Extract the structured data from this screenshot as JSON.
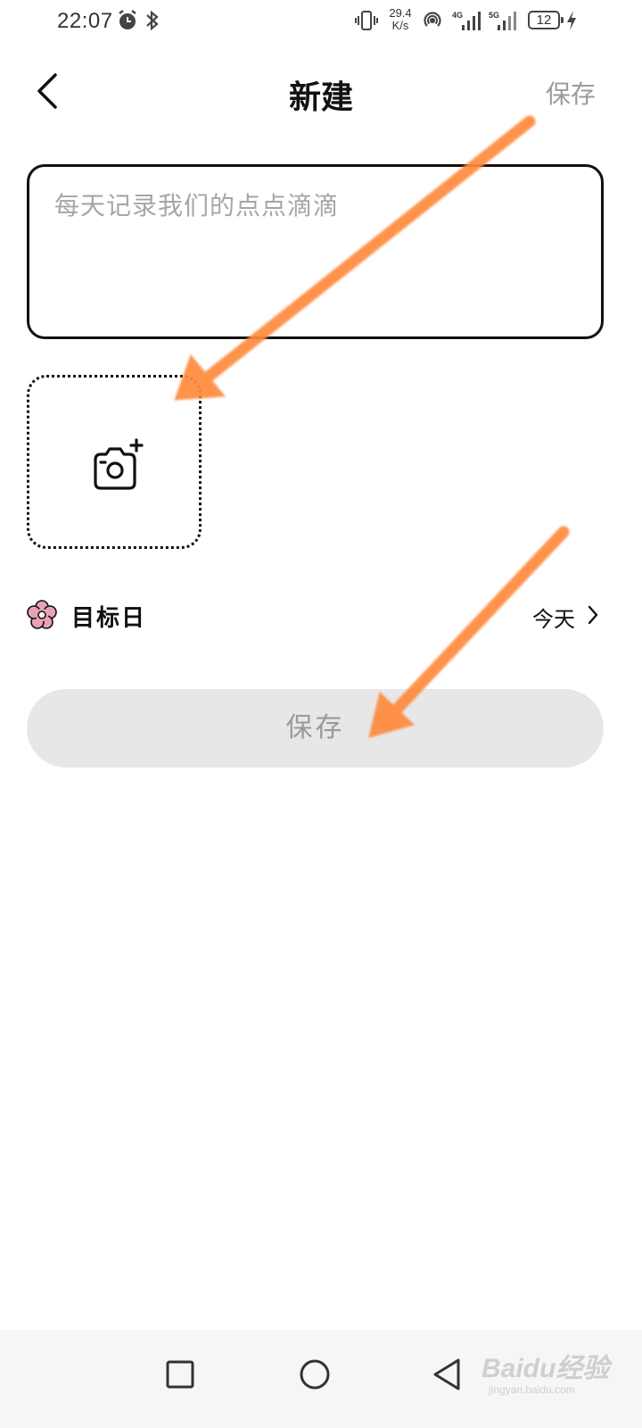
{
  "status_bar": {
    "time": "22:07",
    "net_speed_value": "29.4",
    "net_speed_unit": "K/s",
    "network_1": "4G",
    "network_2": "5G",
    "battery": "12",
    "icons": [
      "alarm-icon",
      "bluetooth-icon",
      "vibrate-icon",
      "hotspot-icon",
      "signal-icon",
      "charging-icon"
    ]
  },
  "header": {
    "title": "新建",
    "save_label": "保存"
  },
  "note": {
    "placeholder": "每天记录我们的点点滴滴"
  },
  "photo": {
    "icon": "camera-add-icon"
  },
  "target_day": {
    "label": "目标日",
    "value": "今天",
    "icon": "flower-icon"
  },
  "save_button": {
    "label": "保存"
  },
  "nav": {
    "buttons": [
      "recents-square-icon",
      "home-circle-icon",
      "back-triangle-icon"
    ]
  },
  "watermark": {
    "text": "Baidu经验",
    "url": "jingyan.baidu.com"
  },
  "colors": {
    "annotation_arrow": "#ff8a3d",
    "disabled_text": "#9a9a9a",
    "button_bg": "#e7e7e7",
    "flower": "#e8a2b4"
  }
}
